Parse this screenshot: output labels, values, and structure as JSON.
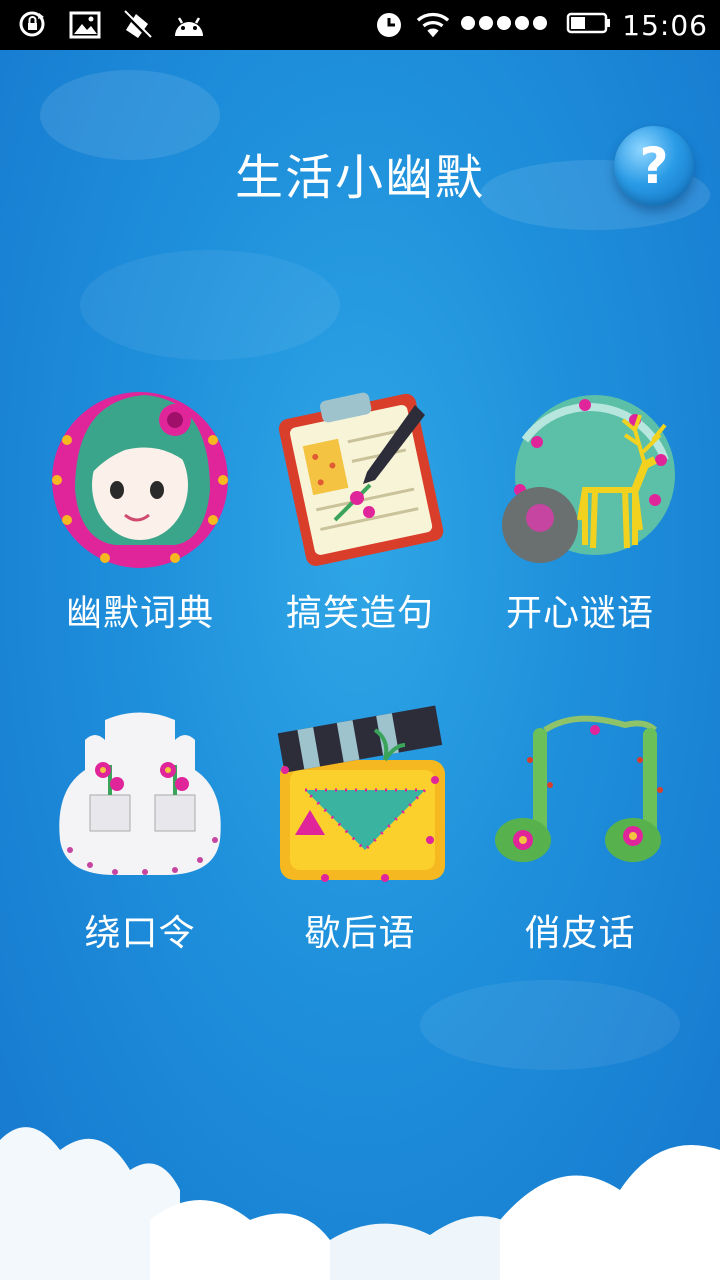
{
  "status_bar": {
    "time": "15:06",
    "left_icons": [
      "sync-lock-icon",
      "image-icon",
      "no-signal-icon",
      "android-icon"
    ],
    "right_icons": [
      "alarm-icon",
      "wifi-icon",
      "signal-dots-icon",
      "battery-icon"
    ]
  },
  "header": {
    "title": "生活小幽默",
    "help_label": "?"
  },
  "menu": {
    "items": [
      {
        "label": "幽默词典",
        "icon": "cartoon-girl-icon"
      },
      {
        "label": "搞笑造句",
        "icon": "clipboard-pencil-icon"
      },
      {
        "label": "开心谜语",
        "icon": "deer-bubble-icon"
      },
      {
        "label": "绕口令",
        "icon": "flower-castle-icon"
      },
      {
        "label": "歇后语",
        "icon": "clapperboard-icon"
      },
      {
        "label": "俏皮话",
        "icon": "music-note-icon"
      }
    ]
  },
  "colors": {
    "background": "#1e8fdb",
    "status_bar": "#000000",
    "text": "#ffffff"
  }
}
